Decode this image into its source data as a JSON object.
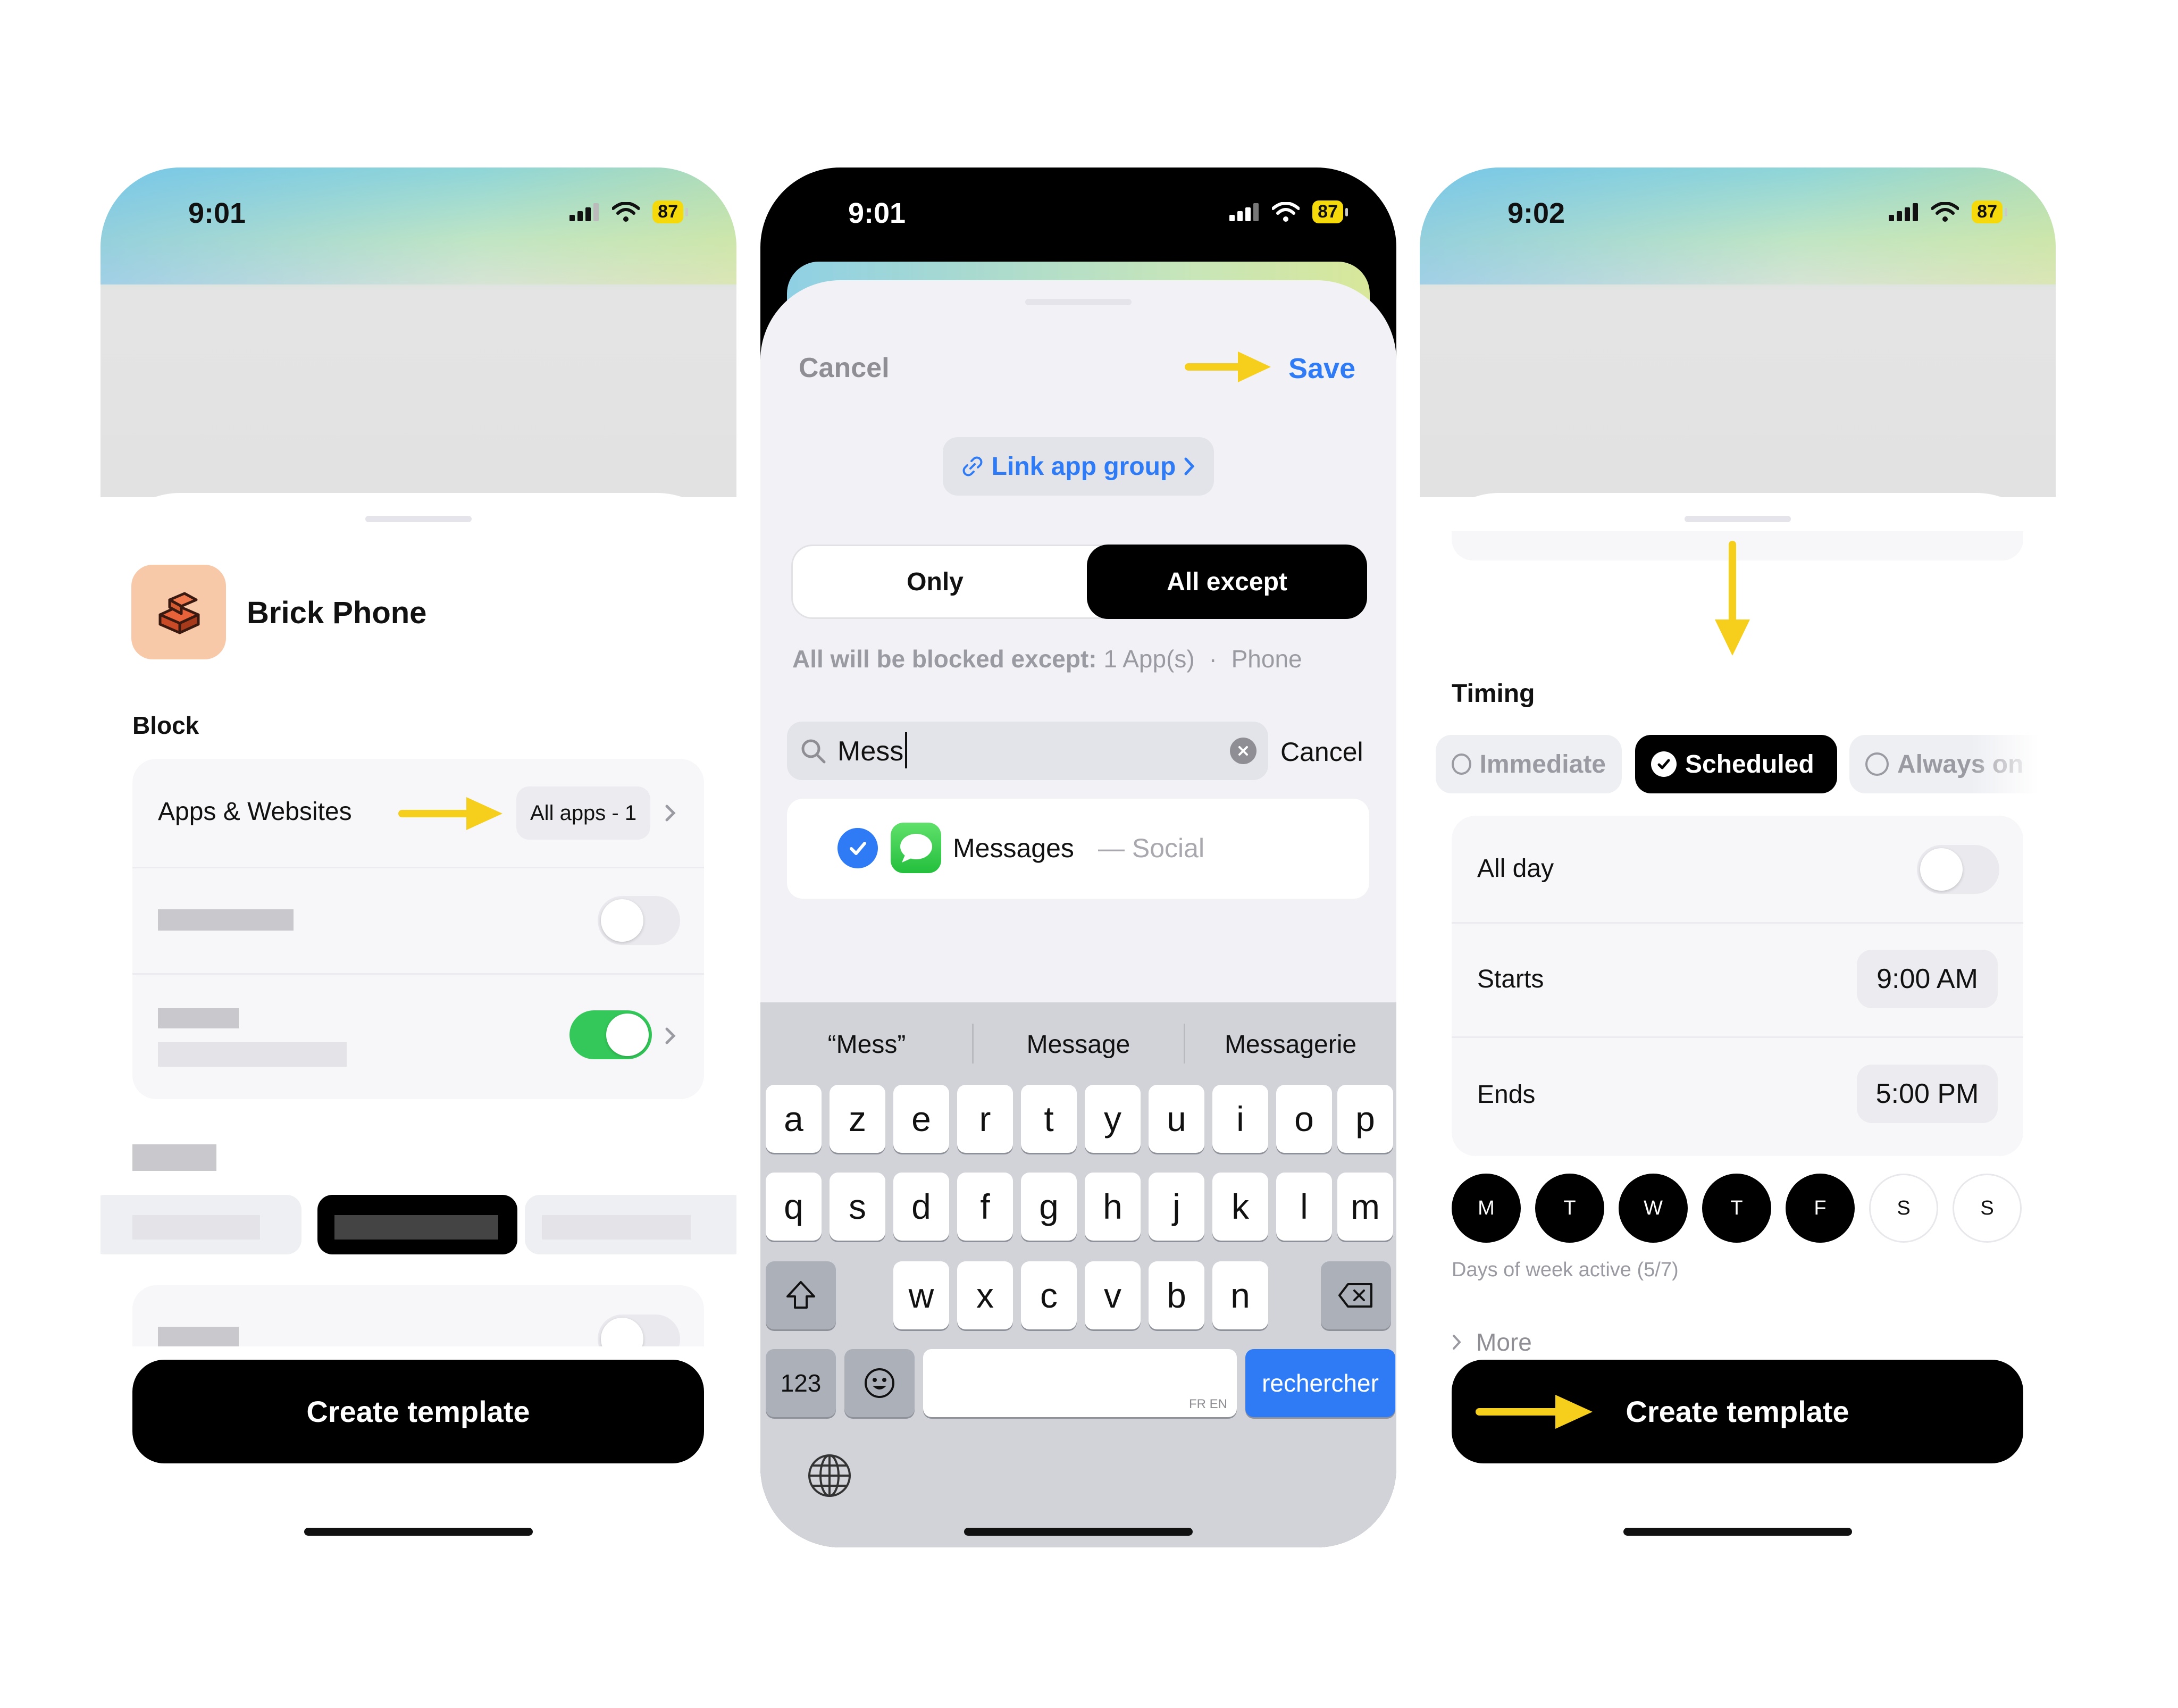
{
  "status_bars": [
    {
      "time": "9:01",
      "battery": "87"
    },
    {
      "time": "9:01",
      "battery": "87"
    },
    {
      "time": "9:02",
      "battery": "87"
    }
  ],
  "screen1": {
    "app_name": "Brick Phone",
    "block_label": "Block",
    "apps_websites_label": "Apps & Websites",
    "apps_badge": "All apps - 1",
    "create_button": "Create template"
  },
  "screen2": {
    "cancel": "Cancel",
    "save": "Save",
    "link_app_group": "Link app group",
    "segment_only": "Only",
    "segment_all_except": "All except",
    "blocked_prefix": "All will be blocked except:",
    "blocked_count": "1 App(s)",
    "blocked_dot": "·",
    "blocked_phone": "Phone",
    "search_value": "Mess",
    "search_cancel": "Cancel",
    "result_app": "Messages",
    "result_category": "— Social",
    "suggestions": [
      "“Mess”",
      "Message",
      "Messagerie"
    ],
    "keys_row1": [
      "a",
      "z",
      "e",
      "r",
      "t",
      "y",
      "u",
      "i",
      "o",
      "p"
    ],
    "keys_row2": [
      "q",
      "s",
      "d",
      "f",
      "g",
      "h",
      "j",
      "k",
      "l",
      "m"
    ],
    "keys_row3": [
      "w",
      "x",
      "c",
      "v",
      "b",
      "n"
    ],
    "key_123": "123",
    "space_hint": "FR EN",
    "return_key": "rechercher"
  },
  "screen3": {
    "timing_label": "Timing",
    "opt_immediate": "Immediate",
    "opt_scheduled": "Scheduled",
    "opt_always": "Always on",
    "all_day": "All day",
    "starts": "Starts",
    "starts_value": "9:00 AM",
    "ends": "Ends",
    "ends_value": "5:00 PM",
    "days": [
      {
        "label": "M",
        "active": true
      },
      {
        "label": "T",
        "active": true
      },
      {
        "label": "W",
        "active": true
      },
      {
        "label": "T",
        "active": true
      },
      {
        "label": "F",
        "active": true
      },
      {
        "label": "S",
        "active": false
      },
      {
        "label": "S",
        "active": false
      }
    ],
    "days_caption": "Days of week active (5/7)",
    "more": "More",
    "create_button": "Create template"
  },
  "colors": {
    "accent_blue": "#2f7bf6",
    "arrow_yellow": "#f5cf1c",
    "toggle_green": "#34c759",
    "battery_yellow": "#f5d90a"
  }
}
